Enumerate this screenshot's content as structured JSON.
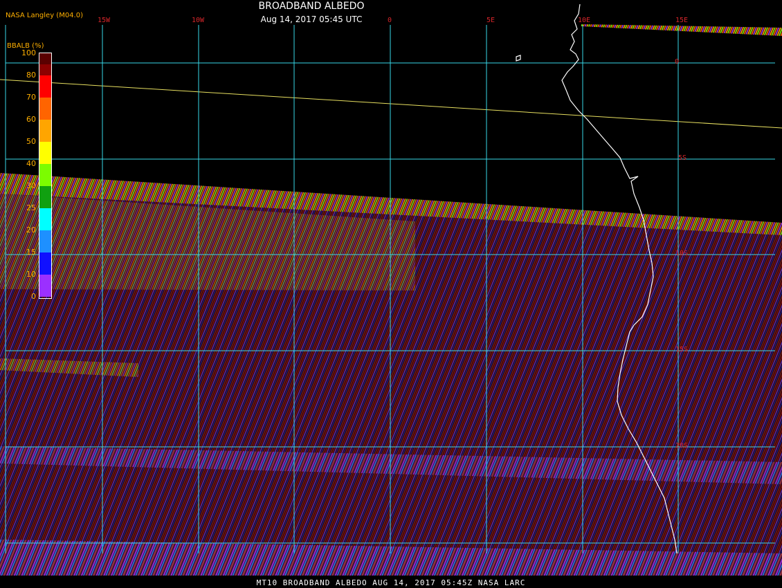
{
  "header": {
    "title": "BROADBAND ALBEDO",
    "datetime": "Aug 14, 2017 05:45 UTC",
    "credit": "NASA Langley (M04.0)"
  },
  "colorbar": {
    "title": "BBALB (%)",
    "labels": [
      "100",
      "80",
      "70",
      "60",
      "50",
      "40",
      "30",
      "25",
      "20",
      "15",
      "10",
      "0"
    ],
    "colors": [
      "#5a0000",
      "#8c0000",
      "#ff0000",
      "#ff6400",
      "#ffa500",
      "#ffff00",
      "#7cfc00",
      "#10a010",
      "#00ffff",
      "#1e90ff",
      "#1010ff",
      "#9b30ff"
    ]
  },
  "grid": {
    "longitudes": [
      "15W",
      "10W",
      "0",
      "5E",
      "10E",
      "15E"
    ],
    "latitudes": [
      "0",
      "5S",
      "10S",
      "15S",
      "20S"
    ]
  },
  "footer": {
    "text": "MT10  BROADBAND ALBEDO   AUG 14, 2017 05:45Z   NASA LARC"
  },
  "colors": {
    "grid": "#38d8e8",
    "coast": "#ffffff",
    "background": "#000000"
  }
}
